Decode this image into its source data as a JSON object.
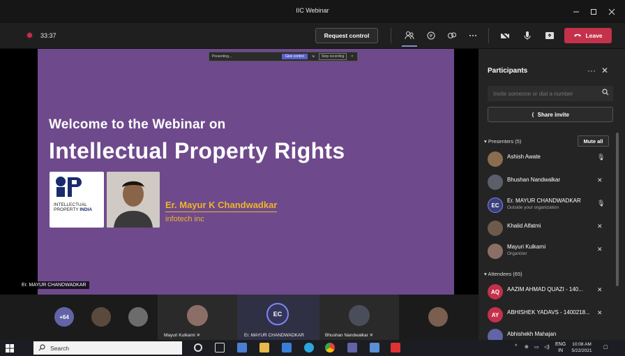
{
  "window": {
    "title": "IIC Webinar"
  },
  "toolbar": {
    "timer": "33:37",
    "request_control": "Request control",
    "leave": "Leave"
  },
  "share_bar": {
    "presenting": "Presenting...",
    "give_control": "Give control",
    "stop_recording": "Stop recording"
  },
  "slide": {
    "title_line1": "Welcome to the Webinar on",
    "title_line2": "Intellectual Property Rights",
    "logo_line1": "INTELLECTUAL",
    "logo_line2": "PROPERTY",
    "logo_line2_bold": "INDIA",
    "presenter": "Er. Mayur K Chandwadkar",
    "company": "infotech inc"
  },
  "stage": {
    "speaker_tag": "Er. MAYUR CHANDWADKAR"
  },
  "tiles": {
    "overflow_count": "+64",
    "items": [
      {
        "label": "Mayuri Kulkarni",
        "initials": ""
      },
      {
        "label": "Er. MAYUR CHANDWADKAR",
        "initials": "EC"
      },
      {
        "label": "Bhushan Nandwalkar",
        "initials": ""
      }
    ]
  },
  "panel": {
    "title": "Participants",
    "invite_placeholder": "Invite someone or dial a number",
    "share_invite": "Share invite",
    "presenters_header": "Presenters (5)",
    "mute_all": "Mute all",
    "attendees_header": "Attendees (65)",
    "presenters": [
      {
        "name": "Ashish Awate",
        "sub": "",
        "initials": "",
        "color": "#8a6d4e"
      },
      {
        "name": "Bhushan Nandwalkar",
        "sub": "",
        "initials": "",
        "color": "#5b5f6a"
      },
      {
        "name": "Er. MAYUR CHANDWADKAR",
        "sub": "Outside your organization",
        "initials": "EC",
        "color": "#3b3f7a"
      },
      {
        "name": "Khalid Alfatmi",
        "sub": "",
        "initials": "",
        "color": "#6e5a4a"
      },
      {
        "name": "Mayuri Kulkarni",
        "sub": "Organizer",
        "initials": "",
        "color": "#8b6f66"
      }
    ],
    "attendees": [
      {
        "name": "AAZIM AHMAD QUAZI - 140...",
        "initials": "AQ",
        "color": "#c4314b"
      },
      {
        "name": "ABHISHEK YADAVS - 1400218...",
        "initials": "AY",
        "color": "#c4314b"
      },
      {
        "name": "Abhishekh Mahajan",
        "initials": "",
        "color": "#6264a7"
      }
    ]
  },
  "taskbar": {
    "search": "Search",
    "lang_top": "ENG",
    "lang_bottom": "IN",
    "time": "10:08 AM",
    "date": "5/22/2021"
  },
  "colors": {
    "slide_bg": "#6e4a8c",
    "accent": "#6264a7",
    "leave": "#c4314b",
    "presenter_gold": "#f0b429"
  }
}
